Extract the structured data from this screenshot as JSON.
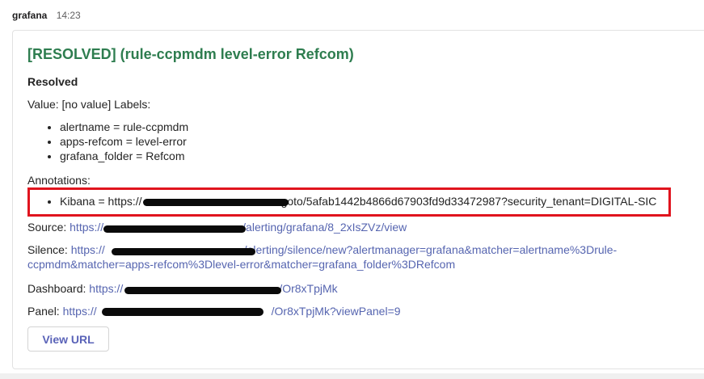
{
  "message": {
    "sender": "grafana",
    "time": "14:23"
  },
  "card": {
    "title": "[RESOLVED] (rule-ccpmdm level-error Refcom)",
    "status": "Resolved",
    "value_line": "Value: [no value] Labels:",
    "labels": [
      "alertname = rule-ccpmdm",
      "apps-refcom = level-error",
      "grafana_folder = Refcom"
    ],
    "annotations_heading": "Annotations:",
    "kibana_prefix": "Kibana = https://",
    "kibana_suffix": "goto/5afab1442b4866d67903fd9d33472987?security_tenant=DIGITAL-SIC",
    "source_label": "Source: ",
    "source_prefix": "https://",
    "source_suffix": "/alerting/grafana/8_2xIsZVz/view",
    "silence_label": "Silence: ",
    "silence_prefix": "https://",
    "silence_suffix": "/alerting/silence/new?alertmanager=grafana&matcher=alertname%3Drule-ccpmdm&matcher=apps-refcom%3Dlevel-error&matcher=grafana_folder%3DRefcom",
    "dashboard_label": "Dashboard: ",
    "dashboard_prefix": "https://",
    "dashboard_suffix": "/Or8xTpjMk",
    "panel_label": "Panel: ",
    "panel_prefix": "https://",
    "panel_suffix": "/Or8xTpjMk?viewPanel=9",
    "view_url_label": "View URL"
  },
  "colors": {
    "title": "#2e7d4f",
    "link": "#5665b0",
    "highlight_border": "#e0141e"
  }
}
